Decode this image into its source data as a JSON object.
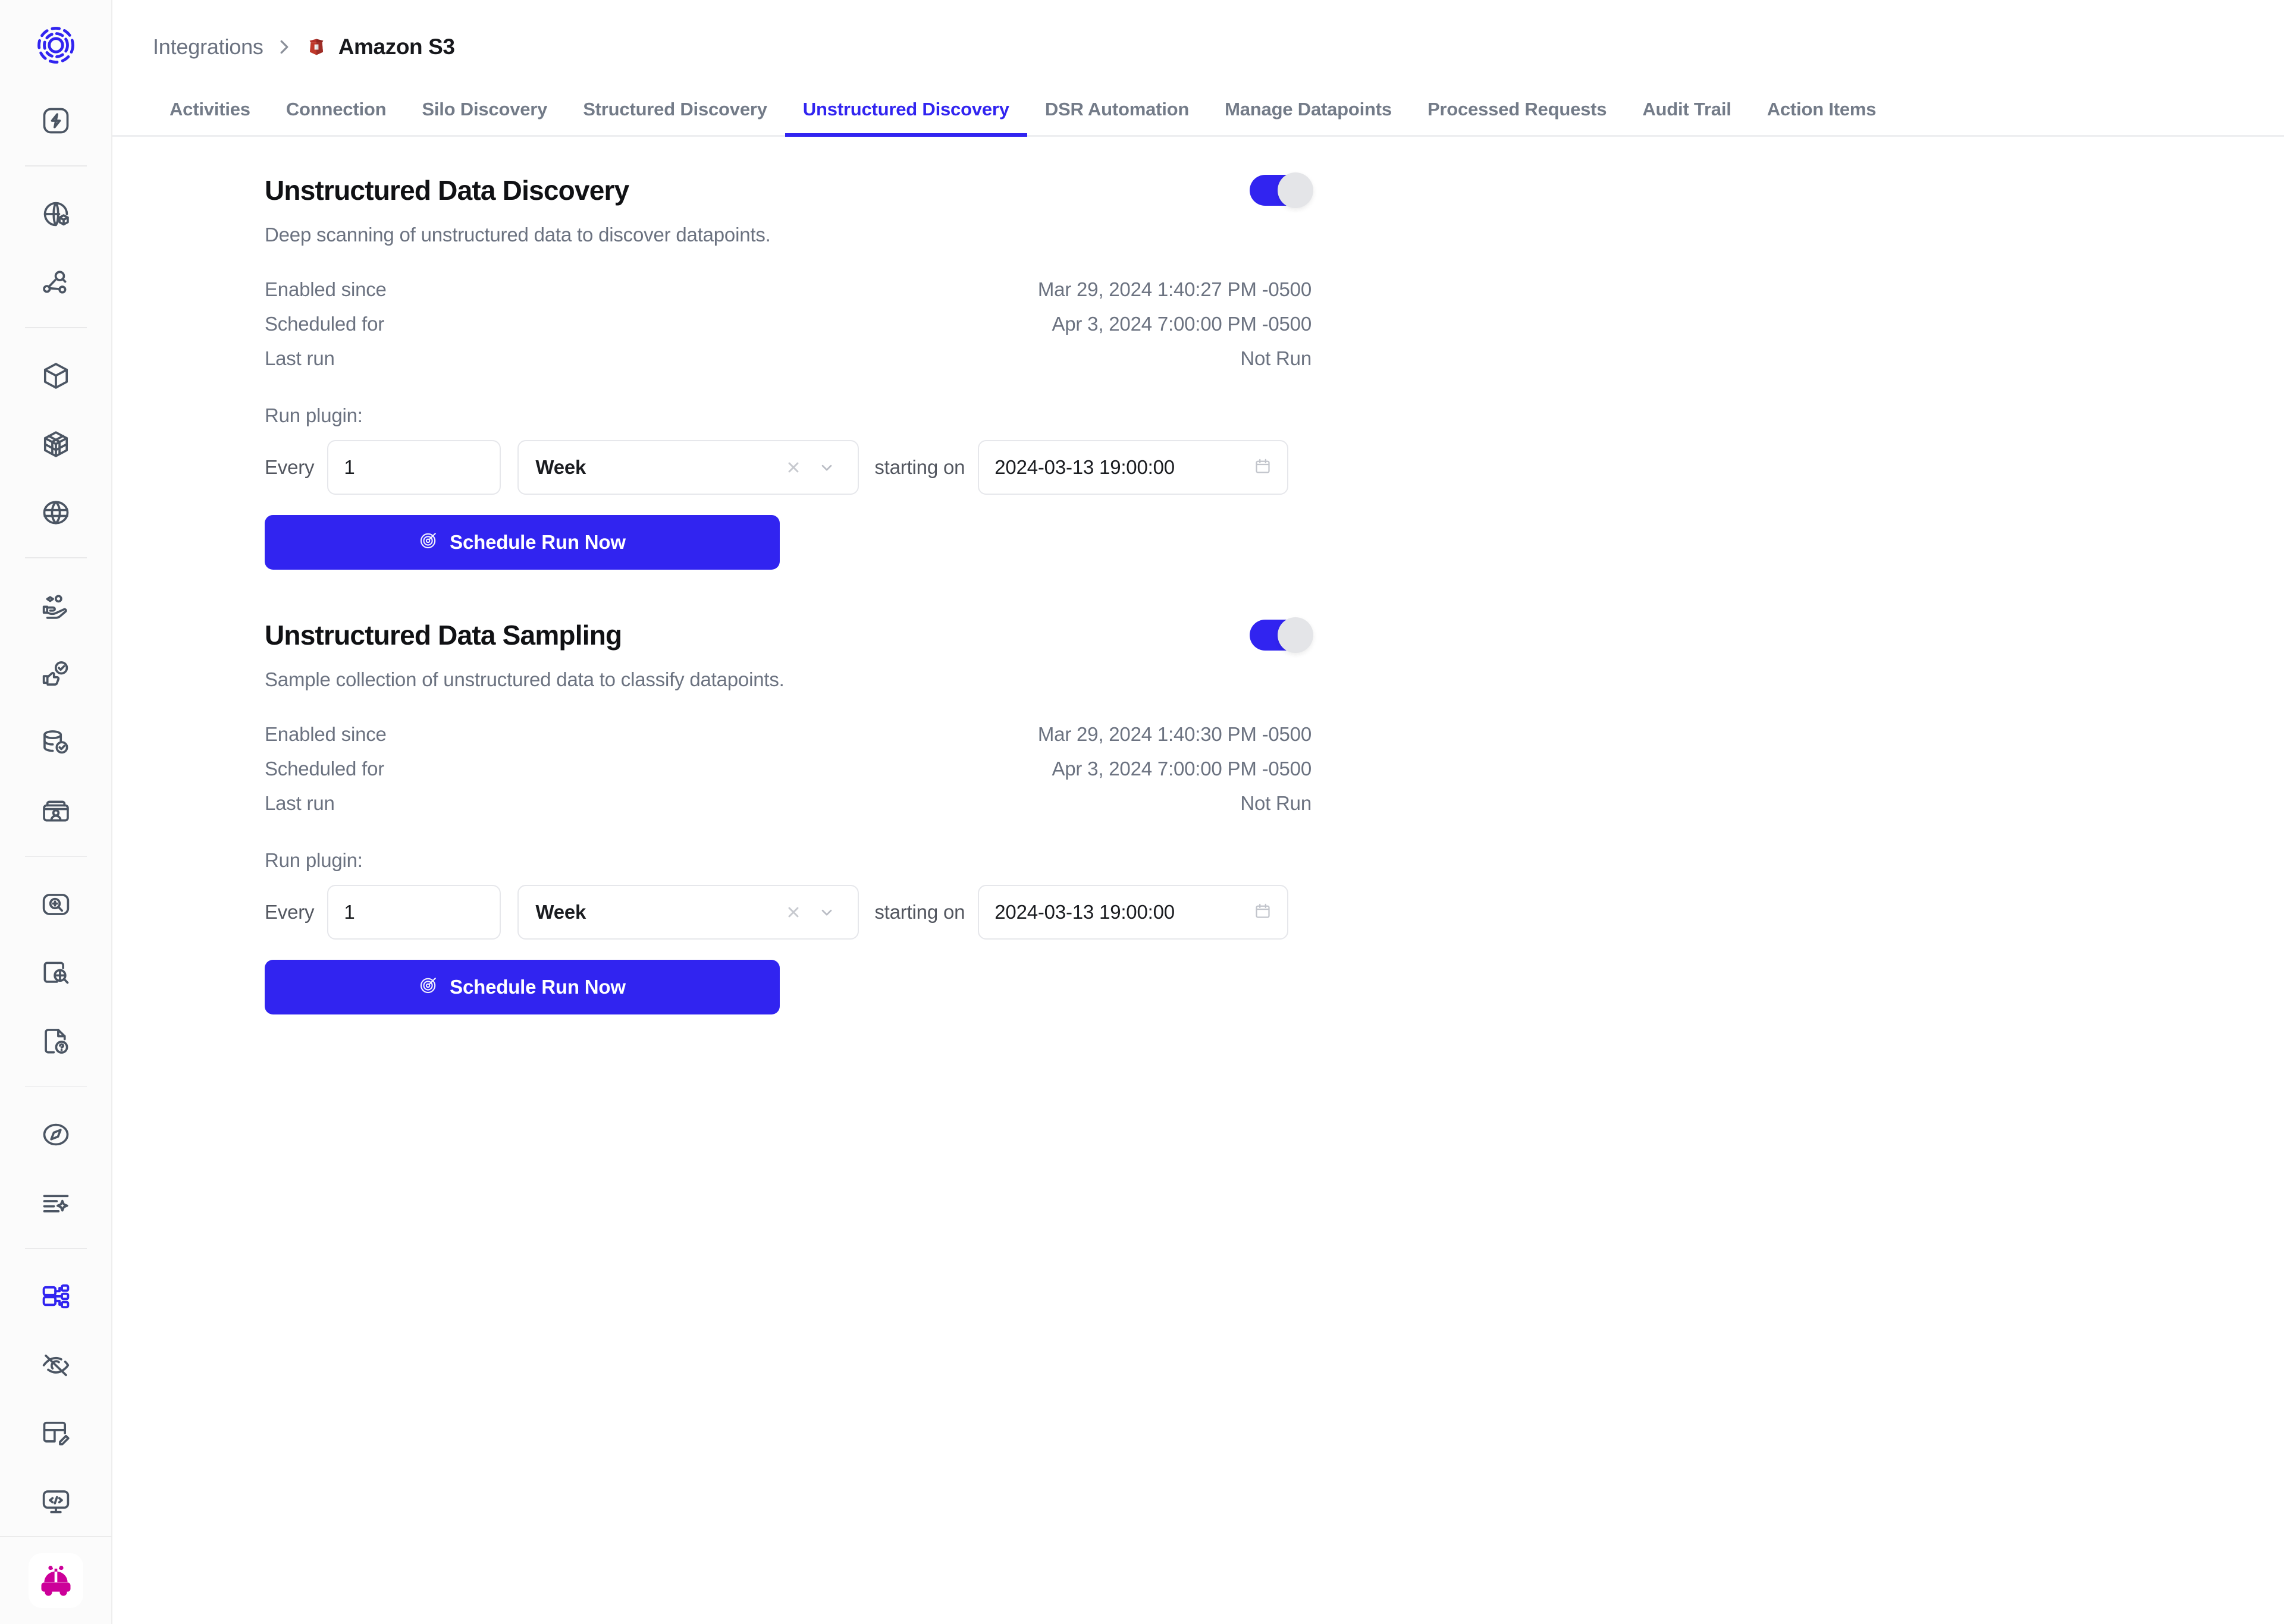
{
  "sidebar": {
    "logo": "discovery-logo",
    "groups": [
      {
        "items": [
          {
            "icon": "lightning-bolt-icon",
            "name": "activity"
          }
        ]
      },
      {
        "items": [
          {
            "icon": "globe-package-icon",
            "name": "data-map"
          },
          {
            "icon": "node-search-icon",
            "name": "data-discovery"
          }
        ]
      },
      {
        "items": [
          {
            "icon": "cube-icon",
            "name": "assets"
          },
          {
            "icon": "grid-cube-icon",
            "name": "data-inventory"
          },
          {
            "icon": "globe-icon",
            "name": "global-view"
          }
        ]
      },
      {
        "items": [
          {
            "icon": "hand-data-icon",
            "name": "consent"
          },
          {
            "icon": "thumb-check-icon",
            "name": "approvals"
          },
          {
            "icon": "database-check-icon",
            "name": "data-sources"
          },
          {
            "icon": "id-card-icon",
            "name": "identities"
          }
        ]
      },
      {
        "items": [
          {
            "icon": "scan-zoom-icon",
            "name": "scan"
          },
          {
            "icon": "document-search-icon",
            "name": "document-discovery"
          },
          {
            "icon": "file-question-icon",
            "name": "requests"
          }
        ]
      },
      {
        "items": [
          {
            "icon": "compass-icon",
            "name": "navigator"
          },
          {
            "icon": "text-sparkle-icon",
            "name": "ai-assist"
          }
        ]
      },
      {
        "items": [
          {
            "icon": "database-tree-icon",
            "name": "integrations",
            "active": true
          },
          {
            "icon": "eye-off-icon",
            "name": "masking"
          },
          {
            "icon": "layout-edit-icon",
            "name": "templates"
          },
          {
            "icon": "code-monitor-icon",
            "name": "developer"
          }
        ]
      }
    ],
    "avatar": "toy-car-avatar"
  },
  "header": {
    "breadcrumb": {
      "root": "Integrations",
      "separator": "chevron-right-icon",
      "current": "Amazon S3",
      "current_icon": "amazon-s3-icon"
    },
    "tabs": [
      {
        "label": "Activities",
        "active": false
      },
      {
        "label": "Connection",
        "active": false
      },
      {
        "label": "Silo Discovery",
        "active": false
      },
      {
        "label": "Structured Discovery",
        "active": false
      },
      {
        "label": "Unstructured Discovery",
        "active": true
      },
      {
        "label": "DSR Automation",
        "active": false
      },
      {
        "label": "Manage Datapoints",
        "active": false
      },
      {
        "label": "Processed Requests",
        "active": false
      },
      {
        "label": "Audit Trail",
        "active": false
      },
      {
        "label": "Action Items",
        "active": false
      }
    ]
  },
  "sections": [
    {
      "title": "Unstructured Data Discovery",
      "description": "Deep scanning of unstructured data to discover datapoints.",
      "toggle_on": true,
      "meta": [
        {
          "label": "Enabled since",
          "value": "Mar 29, 2024 1:40:27 PM -0500"
        },
        {
          "label": "Scheduled for",
          "value": "Apr 3, 2024 7:00:00 PM -0500"
        },
        {
          "label": "Last run",
          "value": "Not Run"
        }
      ],
      "run_plugin_label": "Run plugin:",
      "every_label": "Every",
      "interval_value": "1",
      "unit_value": "Week",
      "unit_clear_icon": "close-icon",
      "unit_chevron_icon": "chevron-down-icon",
      "starting_on_label": "starting on",
      "start_date_value": "2024-03-13 19:00:00",
      "calendar_icon": "calendar-icon",
      "run_button_label": "Schedule Run Now",
      "run_button_icon": "target-icon"
    },
    {
      "title": "Unstructured Data Sampling",
      "description": "Sample collection of unstructured data to classify datapoints.",
      "toggle_on": true,
      "meta": [
        {
          "label": "Enabled since",
          "value": "Mar 29, 2024 1:40:30 PM -0500"
        },
        {
          "label": "Scheduled for",
          "value": "Apr 3, 2024 7:00:00 PM -0500"
        },
        {
          "label": "Last run",
          "value": "Not Run"
        }
      ],
      "run_plugin_label": "Run plugin:",
      "every_label": "Every",
      "interval_value": "1",
      "unit_value": "Week",
      "unit_clear_icon": "close-icon",
      "unit_chevron_icon": "chevron-down-icon",
      "starting_on_label": "starting on",
      "start_date_value": "2024-03-13 19:00:00",
      "calendar_icon": "calendar-icon",
      "run_button_label": "Schedule Run Now",
      "run_button_icon": "target-icon"
    }
  ],
  "colors": {
    "accent": "#3124f0",
    "tab_inactive": "#737b88",
    "muted_text": "#6b7280",
    "s3_red": "#c0392b",
    "avatar_pink": "#ce0municipal"
  }
}
